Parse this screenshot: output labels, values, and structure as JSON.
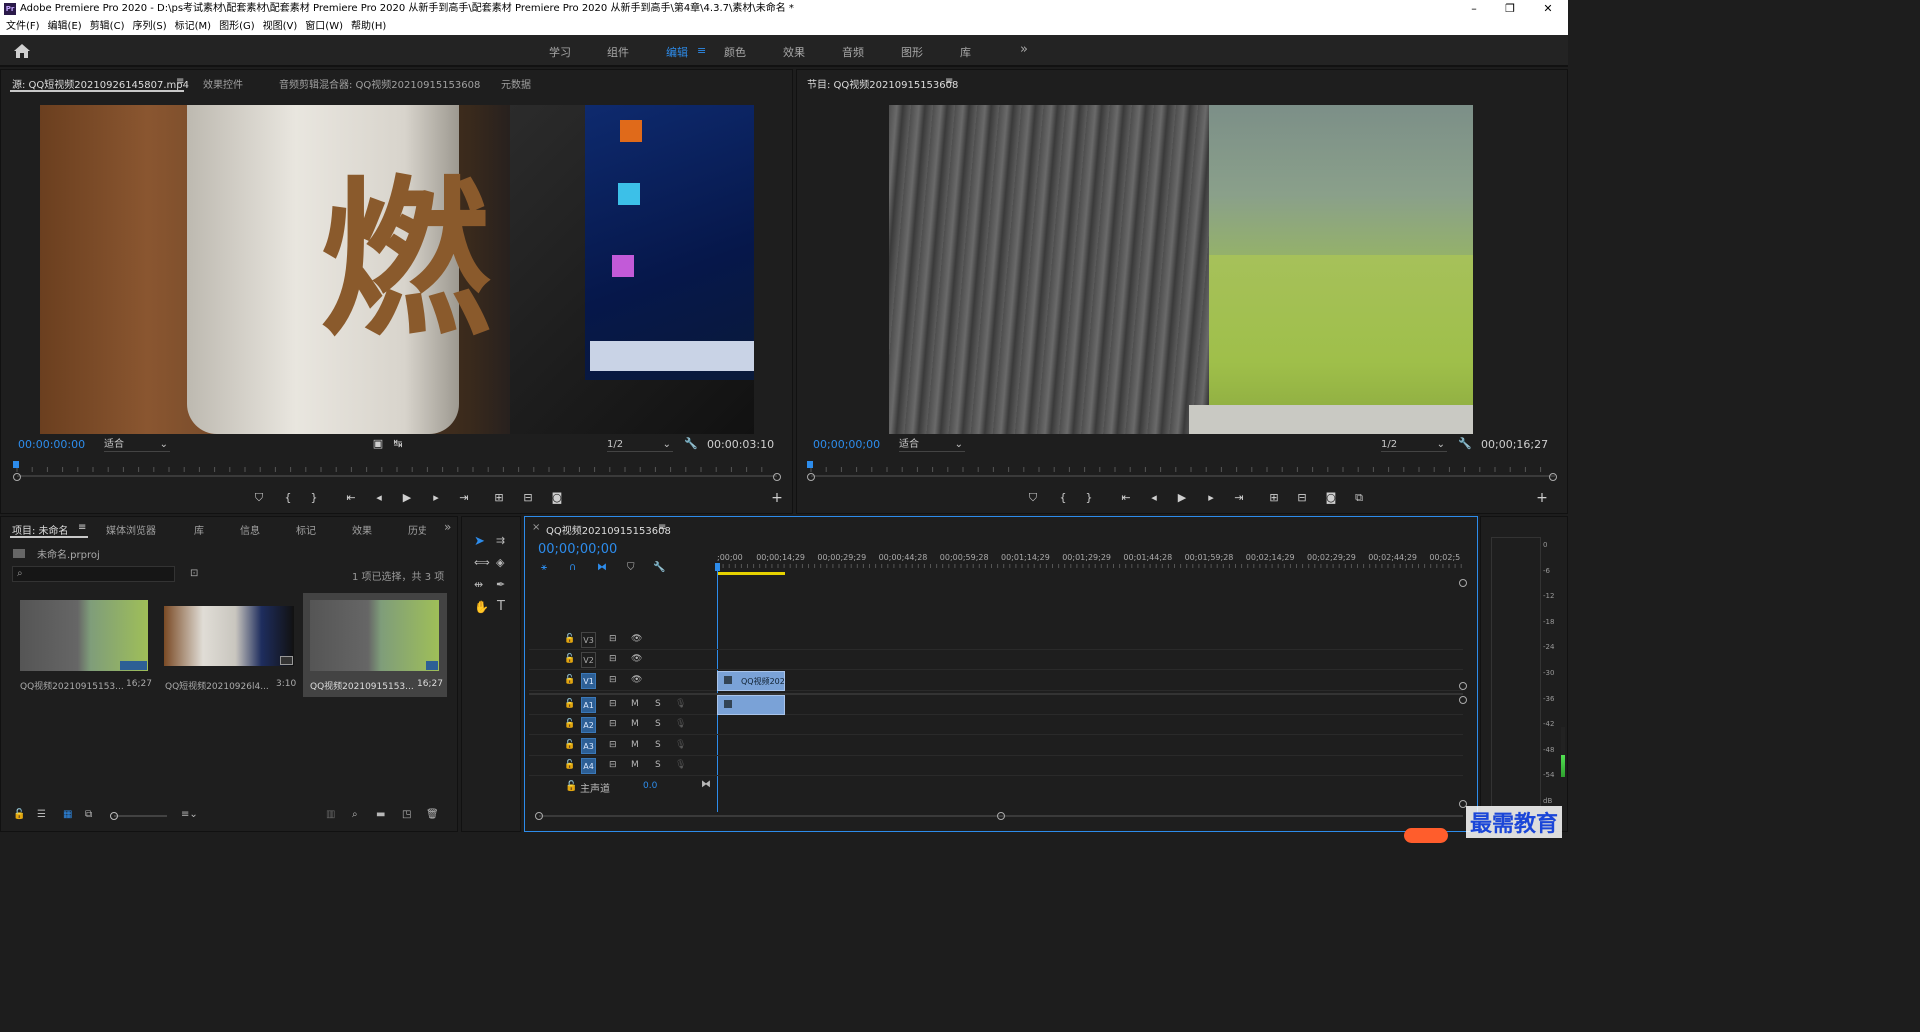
{
  "app": {
    "title": "Adobe Premiere Pro 2020 - D:\\ps考试素材\\配套素材\\配套素材 Premiere Pro 2020 从新手到高手\\配套素材 Premiere Pro 2020 从新手到高手\\第4章\\4.3.7\\素材\\未命名 *",
    "logo_text": "Pr",
    "win_min": "–",
    "win_restore": "❐",
    "win_close": "✕"
  },
  "menu": [
    "文件(F)",
    "编辑(E)",
    "剪辑(C)",
    "序列(S)",
    "标记(M)",
    "图形(G)",
    "视图(V)",
    "窗口(W)",
    "帮助(H)"
  ],
  "workspaces": {
    "tabs": [
      "学习",
      "组件",
      "编辑",
      "颜色",
      "效果",
      "音频",
      "图形",
      "库"
    ],
    "active": "编辑",
    "menu_icon": "≡",
    "more": "»"
  },
  "source": {
    "tabs": [
      "源: QQ短视频20210926145807.mp4",
      "效果控件",
      "音频剪辑混合器: QQ视频20210915153608",
      "元数据"
    ],
    "tab_menu": "≡",
    "timecode": "00:00:00:00",
    "zoom": "适合",
    "resolution": "1/2",
    "duration": "00:00:03:10",
    "frame_label": "燃"
  },
  "program": {
    "tab": "节目: QQ视频20210915153608",
    "tab_menu": "≡",
    "timecode": "00;00;00;00",
    "zoom": "适合",
    "resolution": "1/2",
    "duration": "00;00;16;27"
  },
  "project": {
    "tabs": [
      "项目: 未命名",
      "媒体浏览器",
      "库",
      "信息",
      "标记",
      "效果",
      "历史"
    ],
    "tab_menu": "≡",
    "more": "»",
    "project_file": "未命名.prproj",
    "search_placeholder": "",
    "selection_status": "1 项已选择，共 3 项",
    "items": [
      {
        "name": "QQ视频20210915153...",
        "duration": "16;27",
        "selected": false
      },
      {
        "name": "QQ短视频20210926l4...",
        "duration": "3:10",
        "selected": false
      },
      {
        "name": "QQ视频20210915153...",
        "duration": "16;27",
        "selected": true
      }
    ]
  },
  "timeline": {
    "tab": "QQ视频20210915153608",
    "tab_close": "×",
    "tab_menu": "≡",
    "timecode": "00;00;00;00",
    "ruler_labels": [
      ";00;00",
      "00;00;14;29",
      "00;00;29;29",
      "00;00;44;28",
      "00;00;59;28",
      "00;01;14;29",
      "00;01;29;29",
      "00;01;44;28",
      "00;01;59;28",
      "00;02;14;29",
      "00;02;29;29",
      "00;02;44;29",
      "00;02;5"
    ],
    "video_tracks": [
      "V3",
      "V2",
      "V1"
    ],
    "audio_tracks": [
      "A1",
      "A2",
      "A3",
      "A4"
    ],
    "mute": "M",
    "solo": "S",
    "master_label": "主声道",
    "master_value": "0.0",
    "clip_label": "QQ视频202"
  },
  "meter": {
    "db_labels": [
      "0",
      "-6",
      "-12",
      "-18",
      "-24",
      "-30",
      "-36",
      "-42",
      "-48",
      "-54",
      "dB"
    ],
    "level": 0.22
  },
  "watermark": {
    "text": "最需教育"
  },
  "colors": {
    "accent": "#2d8ceb",
    "clip": "#7aa2d7",
    "playhead": "#2d8ceb",
    "work_area": "#e6d200"
  }
}
